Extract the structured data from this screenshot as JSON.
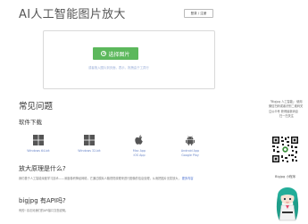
{
  "header": {
    "site_title": "AI人工智能图片放大",
    "login_label": "登录 / 注册"
  },
  "upload": {
    "button_label": "选择图片",
    "hint": "或者拖入图片到页面，表示，拖拽由于工具行"
  },
  "faq": {
    "title": "常见问题",
    "downloads_title": "软件下载",
    "downloads": [
      {
        "label": "Windows 64-bit",
        "icon": "windows-icon"
      },
      {
        "label": "Windows 32-bit",
        "icon": "windows-icon"
      },
      {
        "label": "Mac App",
        "label2": "iOS App",
        "icon": "apple-icon"
      },
      {
        "label": "Android App",
        "label2": "Google Play",
        "icon": "android-icon"
      }
    ],
    "principle_title": "放大原理是什么?",
    "principle_text": "我们基于人工智能深度学习技术——深度卷积神经网络，它通过模拟人脑视觉原理来进行图像的信息处理，从而把图片无损放大，",
    "principle_link": "更多内容",
    "api_title": "bigjpg 有API吗?",
    "api_text": "有的! 请访问我们的API接口文档说明。"
  },
  "side": {
    "intro": "「Bigjpg 人工智能」 使用微信扫码或者识别二维码关注公众号 获得最新消息",
    "follow": "扫一扫关注",
    "mini_program": "Bigjpg 小程序"
  },
  "colors": {
    "accent_green": "#5cb85c",
    "link_blue": "#6a86c8"
  }
}
